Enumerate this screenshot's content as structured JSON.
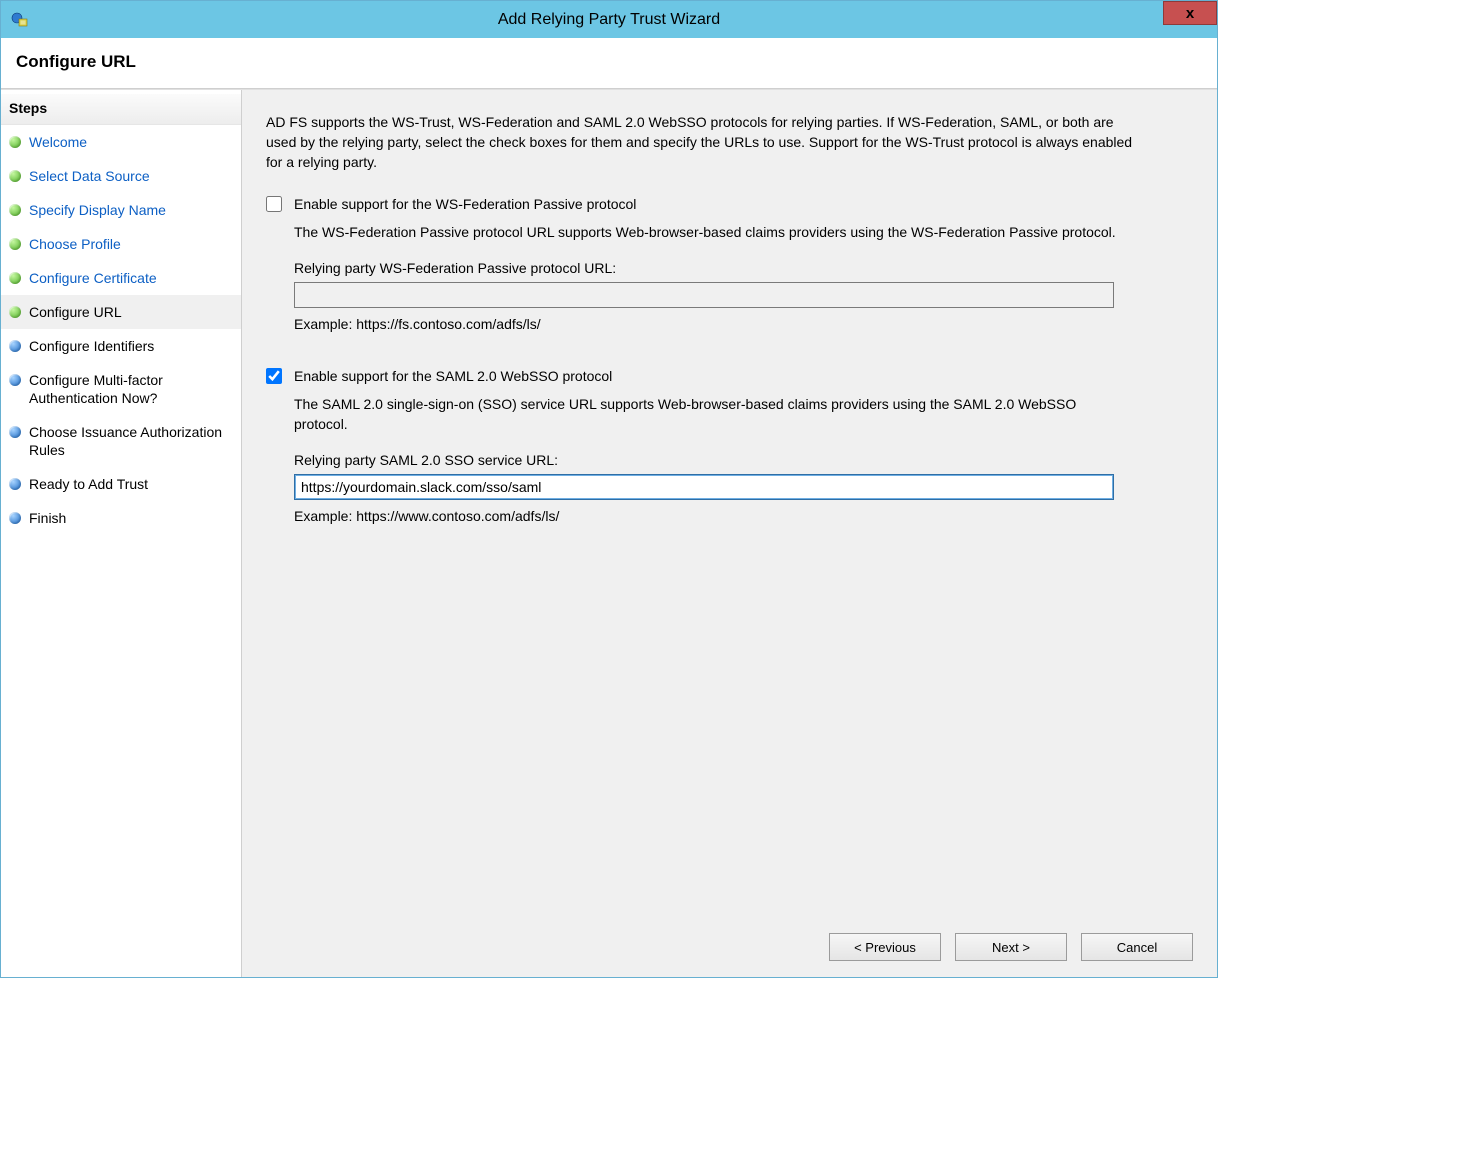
{
  "window": {
    "title": "Add Relying Party Trust Wizard",
    "close_symbol": "x"
  },
  "header": {
    "page_title": "Configure URL"
  },
  "steps": {
    "heading": "Steps",
    "items": [
      {
        "label": "Welcome",
        "state": "completed"
      },
      {
        "label": "Select Data Source",
        "state": "completed"
      },
      {
        "label": "Specify Display Name",
        "state": "completed"
      },
      {
        "label": "Choose Profile",
        "state": "completed"
      },
      {
        "label": "Configure Certificate",
        "state": "completed"
      },
      {
        "label": "Configure URL",
        "state": "current"
      },
      {
        "label": "Configure Identifiers",
        "state": "upcoming"
      },
      {
        "label": "Configure Multi-factor Authentication Now?",
        "state": "upcoming"
      },
      {
        "label": "Choose Issuance Authorization Rules",
        "state": "upcoming"
      },
      {
        "label": "Ready to Add Trust",
        "state": "upcoming"
      },
      {
        "label": "Finish",
        "state": "upcoming"
      }
    ]
  },
  "main": {
    "intro": "AD FS supports the WS-Trust, WS-Federation and SAML 2.0 WebSSO protocols for relying parties.  If WS-Federation, SAML, or both are used by the relying party, select the check boxes for them and specify the URLs to use.  Support for the WS-Trust protocol is always enabled for a relying party.",
    "wsfed": {
      "checkbox_label": "Enable support for the WS-Federation Passive protocol",
      "checked": false,
      "description": "The WS-Federation Passive protocol URL supports Web-browser-based claims providers using the WS-Federation Passive protocol.",
      "url_label": "Relying party WS-Federation Passive protocol URL:",
      "url_value": "",
      "example": "Example: https://fs.contoso.com/adfs/ls/"
    },
    "saml": {
      "checkbox_label": "Enable support for the SAML 2.0 WebSSO protocol",
      "checked": true,
      "description": "The SAML 2.0 single-sign-on (SSO) service URL supports Web-browser-based claims providers using the SAML 2.0 WebSSO protocol.",
      "url_label": "Relying party SAML 2.0 SSO service URL:",
      "url_value": "https://yourdomain.slack.com/sso/saml",
      "example": "Example: https://www.contoso.com/adfs/ls/"
    }
  },
  "buttons": {
    "previous": "< Previous",
    "next": "Next >",
    "cancel": "Cancel"
  }
}
